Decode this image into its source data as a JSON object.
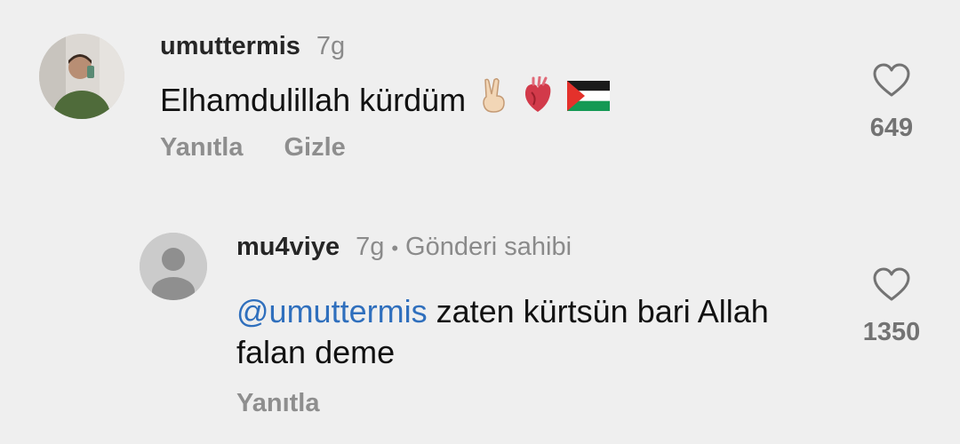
{
  "comments": [
    {
      "username": "umuttermis",
      "time": "7g",
      "text": "Elhamdulillah kürdüm",
      "emojis": [
        "victory-hand-icon",
        "anatomical-heart-icon",
        "palestine-flag-icon"
      ],
      "actions": [
        "Yanıtla",
        "Gizle"
      ],
      "likes": "649"
    },
    {
      "username": "mu4viye",
      "time": "7g",
      "owner_badge": "Gönderi sahibi",
      "mention": "@umuttermis",
      "text": " zaten kürtsün bari Allah falan deme",
      "actions": [
        "Yanıtla"
      ],
      "likes": "1350"
    }
  ]
}
